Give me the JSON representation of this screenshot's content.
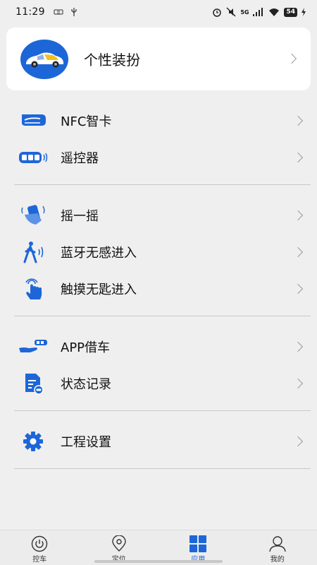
{
  "status_bar": {
    "time": "11:29",
    "network": "5G",
    "battery": "54"
  },
  "profile": {
    "label": "个性装扮"
  },
  "menu_groups": [
    [
      {
        "label": "NFC智卡",
        "icon": "nfc-card-icon"
      },
      {
        "label": "遥控器",
        "icon": "remote-key-icon"
      }
    ],
    [
      {
        "label": "摇一摇",
        "icon": "shake-phone-icon"
      },
      {
        "label": "蓝牙无感进入",
        "icon": "bluetooth-walk-icon"
      },
      {
        "label": "触摸无匙进入",
        "icon": "touch-hand-icon"
      }
    ],
    [
      {
        "label": "APP借车",
        "icon": "car-share-icon"
      },
      {
        "label": "状态记录",
        "icon": "status-record-icon"
      }
    ],
    [
      {
        "label": "工程设置",
        "icon": "gear-icon"
      }
    ]
  ],
  "bottom_nav": [
    {
      "label": "控车",
      "icon": "power-icon",
      "active": false
    },
    {
      "label": "定位",
      "icon": "location-pin-icon",
      "active": false
    },
    {
      "label": "应用",
      "icon": "apps-grid-icon",
      "active": true
    },
    {
      "label": "我的",
      "icon": "user-icon",
      "active": false
    }
  ],
  "colors": {
    "accent": "#1d66d8",
    "background": "#efefef",
    "card": "#ffffff"
  }
}
